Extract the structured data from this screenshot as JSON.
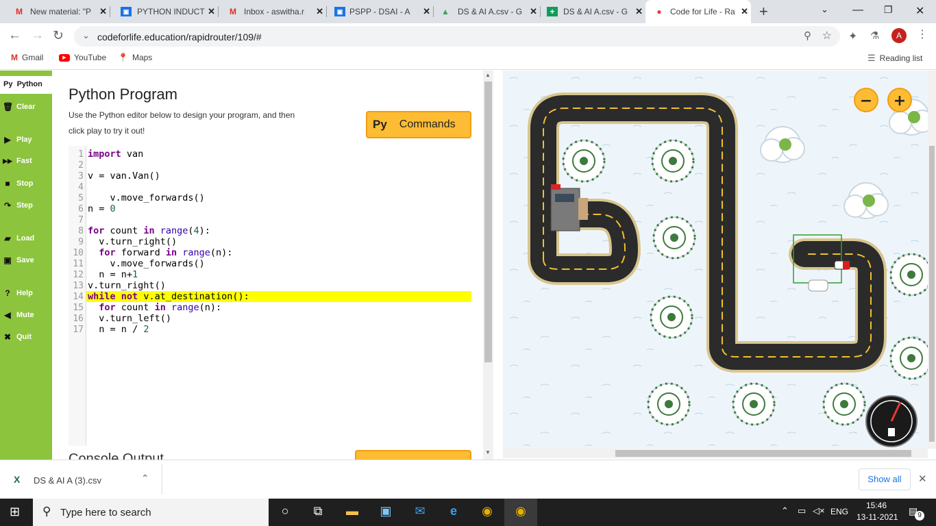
{
  "browser": {
    "tabs": [
      {
        "title": "New material: \"P",
        "icon": "gmail-icon",
        "active": false
      },
      {
        "title": "PYTHON INDUCT",
        "icon": "classroom-icon",
        "active": false
      },
      {
        "title": "Inbox - aswitha.r",
        "icon": "gmail-icon",
        "active": false
      },
      {
        "title": "PSPP - DSAI - A",
        "icon": "classroom-icon",
        "active": false
      },
      {
        "title": "DS & AI A.csv - G",
        "icon": "drive-icon",
        "active": false
      },
      {
        "title": "DS & AI A.csv - G",
        "icon": "sheets-icon",
        "active": false
      },
      {
        "title": "Code for Life - Ra",
        "icon": "codeforlife-icon",
        "active": true
      }
    ],
    "url": "codeforlife.education/rapidrouter/109/#",
    "profile_initial": "A",
    "bookmarks": [
      "Gmail",
      "YouTube",
      "Maps"
    ],
    "reading_list": "Reading list"
  },
  "sidebar": {
    "tab_label": "Python",
    "tab_prefix": "Py",
    "items": [
      {
        "label": "Clear",
        "icon": "trash-icon"
      },
      {
        "label": "Play",
        "icon": "play-icon"
      },
      {
        "label": "Fast",
        "icon": "fast-forward-icon"
      },
      {
        "label": "Stop",
        "icon": "stop-icon"
      },
      {
        "label": "Step",
        "icon": "step-icon"
      },
      {
        "label": "Load",
        "icon": "folder-icon"
      },
      {
        "label": "Save",
        "icon": "save-icon"
      },
      {
        "label": "Help",
        "icon": "help-icon"
      },
      {
        "label": "Mute",
        "icon": "speaker-icon"
      },
      {
        "label": "Quit",
        "icon": "close-icon"
      }
    ]
  },
  "editor": {
    "title": "Python Program",
    "description": "Use the Python editor below to design your program, and then click play to try it out!",
    "commands_prefix": "Py",
    "commands_label": "Commands",
    "console_label": "Console Output",
    "highlight_line": 14,
    "code_lines": [
      "import van",
      "",
      "v = van.Van()",
      "",
      "    v.move_forwards()",
      "n = 0",
      "",
      "for count in range(4):",
      "  v.turn_right()",
      "  for forward in range(n):",
      "    v.move_forwards()",
      "  n = n+1",
      "v.turn_right()",
      "while not v.at_destination():",
      "  for count in range(n):",
      "  v.turn_left()",
      "  n = n / 2"
    ]
  },
  "map": {
    "zoom_out_label": "−",
    "zoom_in_label": "+",
    "fuel_icon": "fuel-gauge-icon"
  },
  "downloads": {
    "file_name": "DS & AI A (3).csv",
    "show_all": "Show all"
  },
  "taskbar": {
    "search_placeholder": "Type here to search",
    "language": "ENG",
    "time": "15:46",
    "date": "13-11-2021",
    "notifications": "9"
  },
  "colors": {
    "sidebar": "#8cc43d",
    "commands_button": "#fdbc33",
    "highlight": "#ffff00",
    "road": "#2b2b2b",
    "road_edge": "#d8c690"
  }
}
